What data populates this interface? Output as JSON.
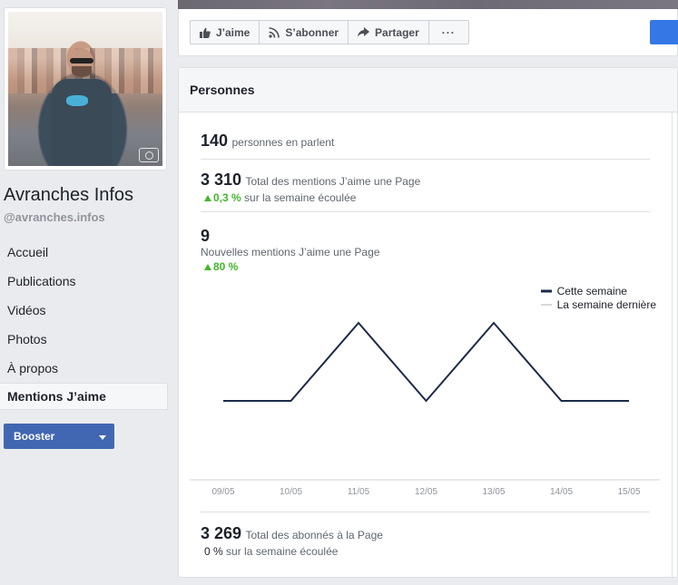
{
  "profile": {
    "name": "Avranches Infos",
    "handle": "@avranches.infos",
    "photo_icon": "camera-icon"
  },
  "sidebar": {
    "items": [
      {
        "label": "Accueil",
        "active": false
      },
      {
        "label": "Publications",
        "active": false
      },
      {
        "label": "Vidéos",
        "active": false
      },
      {
        "label": "Photos",
        "active": false
      },
      {
        "label": "À propos",
        "active": false
      },
      {
        "label": "Mentions J’aime",
        "active": true
      }
    ],
    "booster_label": "Booster"
  },
  "actions": {
    "like": {
      "label": "J’aime",
      "icon": "thumbs-up-icon"
    },
    "follow": {
      "label": "S’abonner",
      "icon": "rss-icon"
    },
    "share": {
      "label": "Partager",
      "icon": "share-arrow-icon"
    },
    "more": {
      "label": "···",
      "icon": "more-icon"
    }
  },
  "panel": {
    "title": "Personnes",
    "talking": {
      "value": "140",
      "label": "personnes en parlent"
    },
    "total_likes": {
      "value": "3 310",
      "label": "Total des mentions J’aime une Page",
      "delta": "0,3 %",
      "delta_label": "sur la semaine écoulée"
    },
    "new_likes": {
      "value": "9",
      "label": "Nouvelles mentions J’aime une Page",
      "delta": "80 %"
    },
    "followers": {
      "value": "3 269",
      "label": "Total des abonnés à la Page",
      "delta": "0 %",
      "delta_label": "sur la semaine écoulée"
    }
  },
  "colors": {
    "accent": "#4267b2",
    "positive": "#42b72a",
    "series_this_week": "#1c2a48",
    "series_last_week": "#b0b3b8"
  },
  "chart_data": {
    "type": "line",
    "x": [
      "09/05",
      "10/05",
      "11/05",
      "12/05",
      "13/05",
      "14/05",
      "15/05"
    ],
    "series": [
      {
        "name": "Cette semaine",
        "values": [
          1,
          1,
          2,
          1,
          2,
          1,
          1
        ]
      },
      {
        "name": "La semaine dernière",
        "values": []
      }
    ],
    "ylim": [
      0,
      2
    ],
    "legend": "top-right",
    "grid": false,
    "title": "",
    "xlabel": "",
    "ylabel": ""
  }
}
